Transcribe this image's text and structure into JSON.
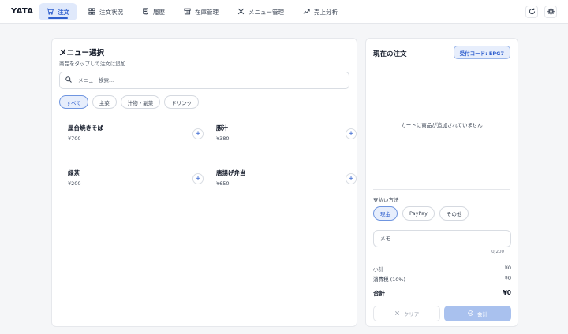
{
  "app": {
    "brand": "YATA"
  },
  "nav": {
    "items": [
      {
        "label": "注文",
        "icon": "cart-icon",
        "active": true
      },
      {
        "label": "注文状況",
        "icon": "grid-icon",
        "active": false
      },
      {
        "label": "履歴",
        "icon": "receipt-icon",
        "active": false
      },
      {
        "label": "在庫管理",
        "icon": "box-icon",
        "active": false
      },
      {
        "label": "メニュー管理",
        "icon": "utensils-icon",
        "active": false
      },
      {
        "label": "売上分析",
        "icon": "chart-icon",
        "active": false
      }
    ]
  },
  "header_actions": {
    "refresh_icon": "refresh-icon",
    "settings_icon": "gear-icon"
  },
  "menu": {
    "title": "メニュー選択",
    "subtitle": "商品をタップして注文に追加",
    "search_placeholder": "メニュー検索...",
    "categories": [
      {
        "label": "すべて",
        "active": true
      },
      {
        "label": "主菜",
        "active": false
      },
      {
        "label": "汁物・副菜",
        "active": false
      },
      {
        "label": "ドリンク",
        "active": false
      }
    ],
    "items": [
      {
        "name": "屋台焼きそば",
        "price": "¥700"
      },
      {
        "name": "豚汁",
        "price": "¥380"
      },
      {
        "name": "緑茶",
        "price": "¥200"
      },
      {
        "name": "唐揚げ弁当",
        "price": "¥650"
      }
    ],
    "add_symbol": "+"
  },
  "order": {
    "title": "現在の注文",
    "code_badge": "受付コード: EPG7",
    "empty_message": "カートに商品が追加されていません",
    "payment_label": "支払い方法",
    "payment_methods": [
      {
        "label": "現金",
        "active": true
      },
      {
        "label": "PayPay",
        "active": false
      },
      {
        "label": "その他",
        "active": false
      }
    ],
    "memo_placeholder": "メモ",
    "memo_count": "0/200",
    "subtotal_label": "小計",
    "subtotal_value": "¥0",
    "tax_label": "消費税 (10%)",
    "tax_value": "¥0",
    "total_label": "合計",
    "total_value": "¥0",
    "clear_label": "クリア",
    "checkout_label": "会計"
  },
  "colors": {
    "accent": "#2f5fce",
    "accent_bg": "#e7eefc",
    "checkout_disabled": "#a9c1ee"
  }
}
